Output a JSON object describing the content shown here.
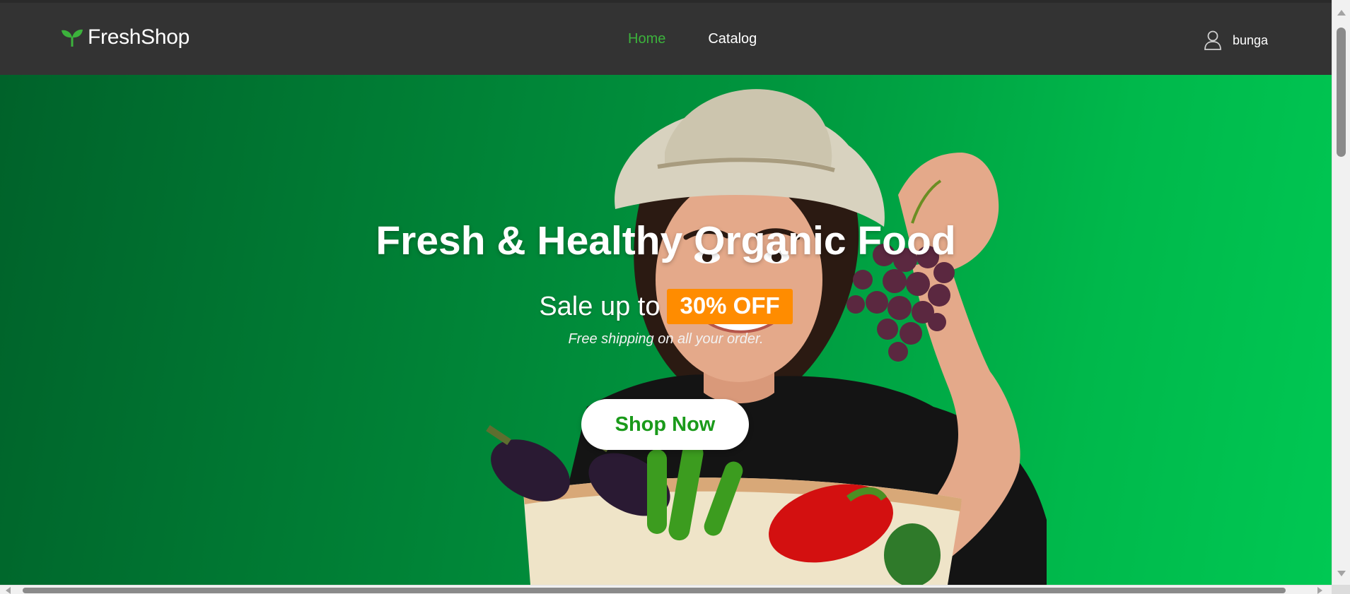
{
  "app": {
    "logo_text": "FreshShop",
    "logo_icon": "sprout-leaf-icon",
    "brand_green": "#3cb23c"
  },
  "nav": {
    "items": [
      {
        "label": "Home",
        "active": true
      },
      {
        "label": "Catalog",
        "active": false
      }
    ]
  },
  "user": {
    "icon": "user-icon",
    "name": "bunga"
  },
  "hero": {
    "title": "Fresh & Healthy Organic Food",
    "sale_prefix": "Sale up to",
    "sale_badge": "30% OFF",
    "shipping_note": "Free shipping on all your order.",
    "cta_label": "Shop Now",
    "badge_color": "#ff8c00",
    "background_color": "#00963e"
  },
  "scrollbars": {
    "vertical": true,
    "horizontal": true
  }
}
